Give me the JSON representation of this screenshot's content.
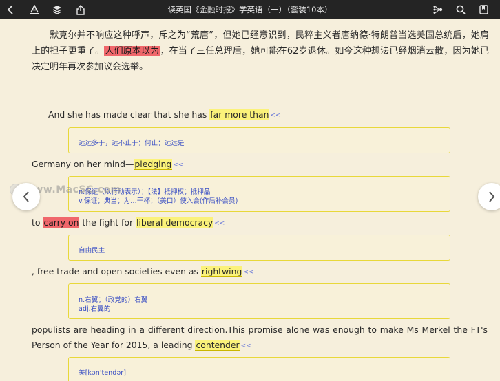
{
  "toolbar": {
    "title": "读英国《金融时报》学英语（一）（套装10本）",
    "left_icons": [
      "back-chevron-icon",
      "font-size-icon",
      "layers-icon",
      "share-icon"
    ],
    "right_icons": [
      "mind-map-icon",
      "search-icon",
      "bookmark-icon"
    ]
  },
  "reader": {
    "para1": {
      "before": "默克尔并不响应这种呼声，斥之为“荒唐”，但她已经意识到，民粹主义者唐纳德·特朗普当选美国总统后，她肩上的担子更重了。",
      "highlight": "人们原本以为",
      "after": "，在当了三任总理后，她可能在62岁退休。如今这种想法已经烟消云散，因为她已决定明年再次参加议会选举。"
    },
    "s1": {
      "before": "And she has made clear that she has ",
      "hl": "far more than",
      "arrow": "<<"
    },
    "n1": [
      "远远多于，远不止于；何止；远远是"
    ],
    "s2": {
      "before": "Germany on her mind—",
      "hl": "pledging",
      "arrow": "<<"
    },
    "n2": [
      "n.保证（以行动表示）；【法】抵押权；抵押品",
      "v.保证；典当；为…干杯；（美口）使入会(作后补会员)"
    ],
    "s3": {
      "before": "to ",
      "red": "carry on",
      "mid": " the fight for ",
      "hl": "liberal democracy",
      "arrow": "<<"
    },
    "n3": [
      "自由民主"
    ],
    "s4": {
      "before": ", free trade and open societies even as ",
      "hl": "rightwing",
      "arrow": "<<"
    },
    "n4": [
      "n.右翼；（政党的）右翼",
      "adj.右翼的"
    ],
    "s5": {
      "line1": "populists are heading in a different direction.This promise alone was enough to make Ms Merkel the FT's",
      "before": "Person of the Year for 2015, a leading ",
      "hl": "contender",
      "arrow": "<<"
    },
    "n5": [
      "美[kən'tendər]"
    ]
  },
  "watermark": {
    "text": "www.MacSC.com"
  },
  "nav": {
    "prev_icon": "chevron-left-icon",
    "next_icon": "chevron-right-icon"
  }
}
